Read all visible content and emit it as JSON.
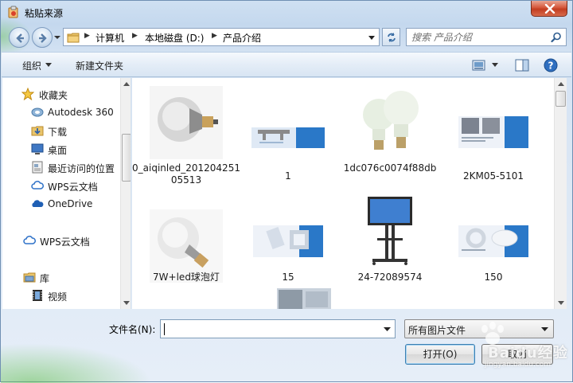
{
  "window": {
    "title": "粘贴来源",
    "icon": "wps-paste-icon"
  },
  "address": {
    "breadcrumbs": [
      "计算机",
      "本地磁盘 (D:)",
      "产品介绍"
    ]
  },
  "search": {
    "placeholder": "搜索 产品介绍"
  },
  "toolbar": {
    "organize_label": "组织",
    "new_folder_label": "新建文件夹"
  },
  "sidebar": {
    "items": [
      {
        "label": "收藏夹",
        "icon": "star-icon"
      },
      {
        "label": "Autodesk 360",
        "icon": "autodesk-icon"
      },
      {
        "label": "下载",
        "icon": "download-folder-icon"
      },
      {
        "label": "桌面",
        "icon": "desktop-icon"
      },
      {
        "label": "最近访问的位置",
        "icon": "recent-places-icon"
      },
      {
        "label": "WPS云文档",
        "icon": "cloud-icon"
      },
      {
        "label": "OneDrive",
        "icon": "onedrive-icon"
      },
      {
        "label": "WPS云文档",
        "icon": "cloud-icon"
      },
      {
        "label": "库",
        "icon": "library-icon"
      },
      {
        "label": "视频",
        "icon": "video-icon"
      }
    ]
  },
  "files": [
    {
      "name": "0_aiqinled_20120425105513",
      "kind": "bulb-gray"
    },
    {
      "name": "1",
      "kind": "banner-blue"
    },
    {
      "name": "1dc076c0074f88db",
      "kind": "bulb-pair"
    },
    {
      "name": "2KM05-5101",
      "kind": "product-sheet"
    },
    {
      "name": "7W+led球泡灯",
      "kind": "bulb-white"
    },
    {
      "name": "15",
      "kind": "panel-sheet"
    },
    {
      "name": "24-72089574",
      "kind": "tv-stand"
    },
    {
      "name": "150",
      "kind": "ring-sheet"
    },
    {
      "name": "",
      "kind": "partial"
    }
  ],
  "footer": {
    "filename_label": "文件名(N):",
    "filename_value": "",
    "filetype_value": "所有图片文件",
    "open_label": "打开(O)",
    "cancel_label": "取消"
  },
  "watermark": {
    "text": "Baidu经验",
    "sub": "jingyan.baidu.com"
  },
  "colors": {
    "close_red": "#c23d20",
    "chrome_blue": "#c4d8ee",
    "selection_border": "#3c7fb1"
  }
}
